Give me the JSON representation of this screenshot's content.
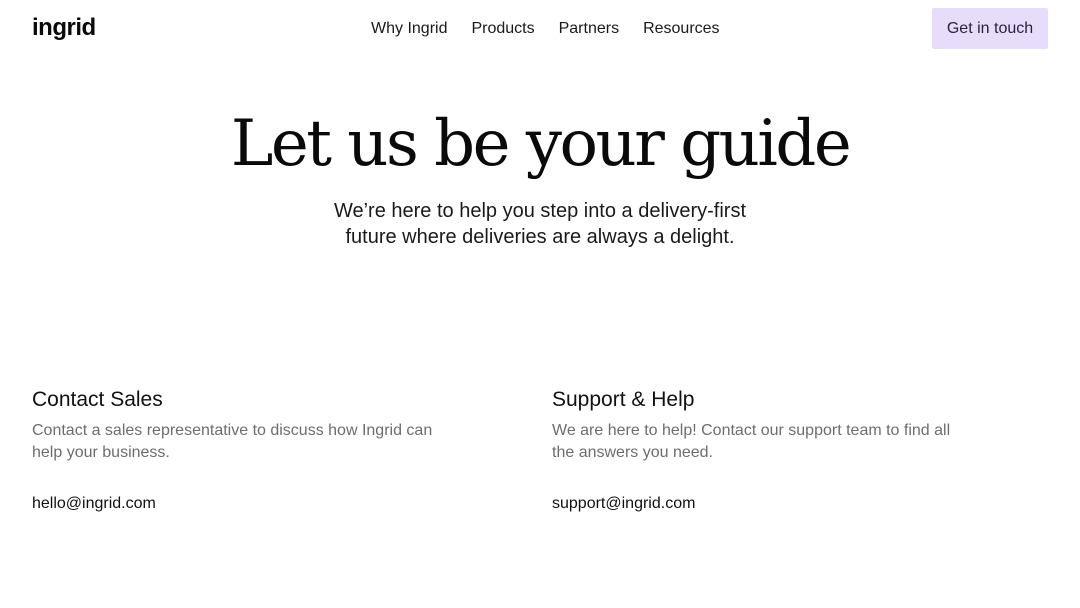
{
  "header": {
    "logo": "ingrid",
    "nav": [
      "Why Ingrid",
      "Products",
      "Partners",
      "Resources"
    ],
    "cta_label": "Get in touch"
  },
  "hero": {
    "title": "Let us be your guide",
    "subtitle": "We’re here to help you step into a delivery-first future where deliveries are always a delight."
  },
  "contacts": [
    {
      "heading": "Contact Sales",
      "description": "Contact a sales representative to discuss how Ingrid can help your business.",
      "email": "hello@ingrid.com"
    },
    {
      "heading": "Support & Help",
      "description": "We are here to help! Contact our support team to find all the answers you need.",
      "email": "support@ingrid.com"
    }
  ],
  "colors": {
    "cta_background": "#e8dcfb",
    "body_text": "#111111",
    "muted_text": "#6d6d6d"
  }
}
